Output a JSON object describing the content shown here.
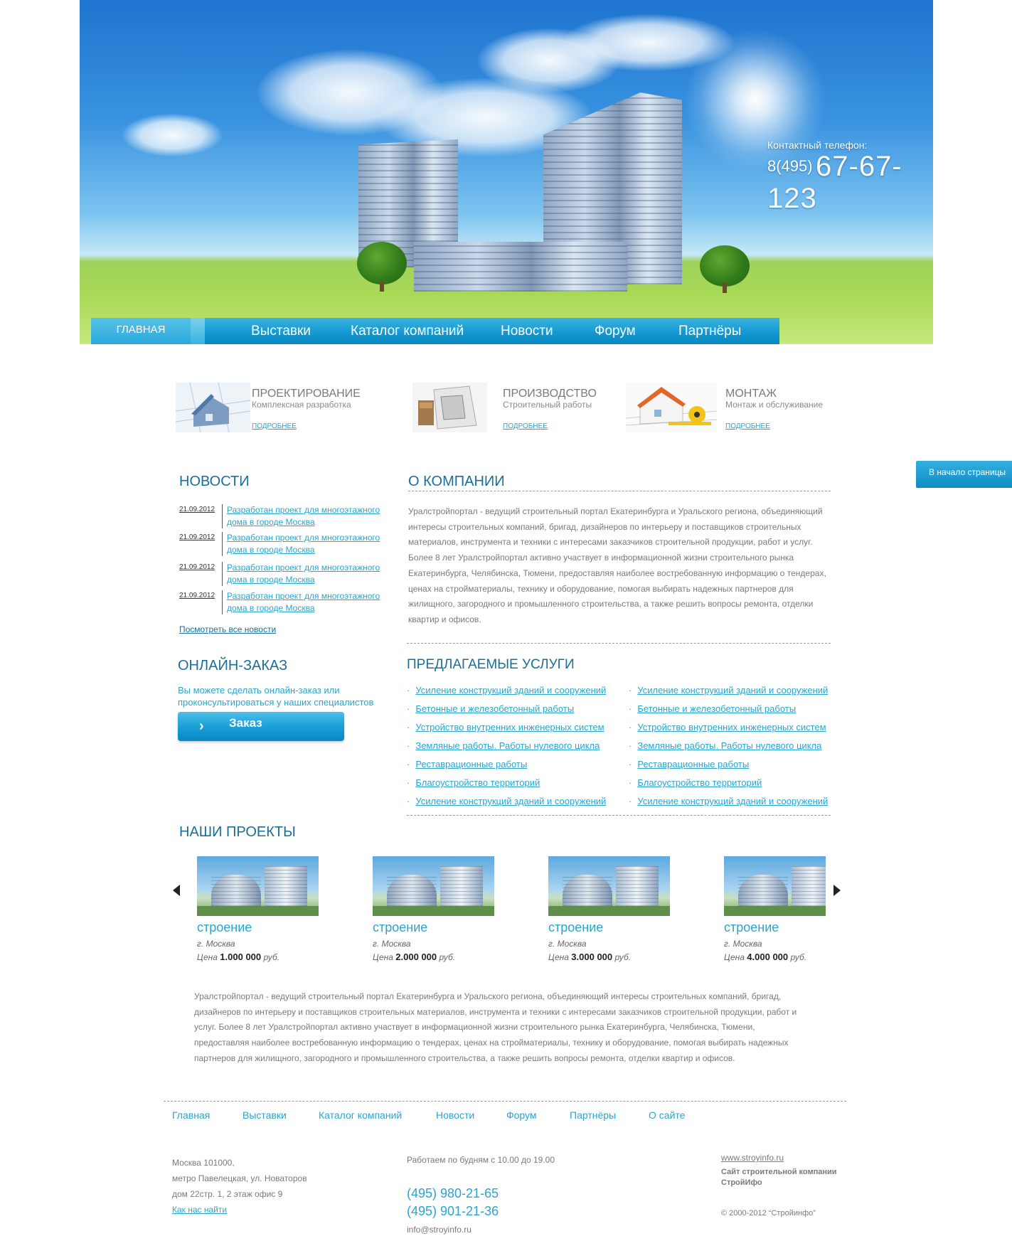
{
  "header": {
    "phone_label": "Контактный телефон:",
    "phone_prefix": "8(495)",
    "phone_number": "67-67-123"
  },
  "nav": {
    "home": "ГЛАВНАЯ",
    "items": [
      "Выставки",
      "Каталог компаний",
      "Новости",
      "Форум",
      "Партнёры"
    ]
  },
  "features": [
    {
      "title": "ПРОЕКТИРОВАНИЕ",
      "subtitle": "Комплексная разработка",
      "more": "ПОДРОБНЕЕ"
    },
    {
      "title": "ПРОИЗВОДСТВО",
      "subtitle": "Строительный работы",
      "more": "ПОДРОБНЕЕ"
    },
    {
      "title": "МОНТАЖ",
      "subtitle": "Монтаж и обслуживание",
      "more": "ПОДРОБНЕЕ"
    }
  ],
  "to_top": "В начало страницы",
  "news": {
    "title": "НОВОСТИ",
    "items": [
      {
        "date": "21.09.2012",
        "text": "Разработан проект для многоэтажного дома в городе Москва"
      },
      {
        "date": "21.09.2012",
        "text": "Разработан проект для многоэтажного дома в городе Москва"
      },
      {
        "date": "21.09.2012",
        "text": "Разработан проект для многоэтажного дома в городе Москва"
      },
      {
        "date": "21.09.2012",
        "text": "Разработан проект для многоэтажного дома в городе Москва"
      }
    ],
    "all_link": "Посмотреть все новости"
  },
  "online": {
    "title": "ОНЛАЙН-ЗАКАЗ",
    "text": "Вы можете сделать онлайн-заказ или проконсультироваться у наших специалистов",
    "button": "Заказ",
    "arrow": "›"
  },
  "about": {
    "title": "О КОМПАНИИ",
    "text": "Уралстройпортал - ведущий строительный портал Екатеринбурга и Уральского региона, объединяющий интересы строительных компаний, бригад, дизайнеров по интерьеру и поставщиков строительных материалов, инструмента и техники с интересами заказчиков строительной продукции, работ и услуг. Более 8 лет Уралстройпортал активно участвует в информационной жизни строительного рынка Екатеринбурга, Челябинска, Тюмени, предоставляя наиболее востребованную информацию о тендерах, ценах на стройматериалы, технику и оборудование, помогая выбирать надежных партнеров для жилищного, загородного и промышленного строительства, а также решить вопросы ремонта, отделки квартир и офисов."
  },
  "services": {
    "title": "ПРЕДЛАГАЕМЫЕ УСЛУГИ",
    "col1": [
      "Усиление конструкций зданий и сооружений",
      "Бетонные и железобетонный работы",
      "Устройство внутренних инженерных систем",
      "Земляные работы. Работы нулевого цикла",
      "Реставрационные работы",
      "Благоустройство территорий",
      "Усиление конструкций зданий и сооружений"
    ],
    "col2": [
      "Усиление конструкций зданий и сооружений",
      "Бетонные и железобетонный работы",
      "Устройство внутренних инженерных систем",
      "Земляные работы. Работы нулевого цикла",
      "Реставрационные работы",
      "Благоустройство территорий",
      "Усиление конструкций зданий и сооружений"
    ]
  },
  "projects": {
    "title": "НАШИ ПРОЕКТЫ",
    "items": [
      {
        "title": "строение",
        "city": "г. Москва",
        "price_label": "Цена",
        "price": "1.000 000",
        "currency": "руб."
      },
      {
        "title": "строение",
        "city": "г. Москва",
        "price_label": "Цена",
        "price": "2.000 000",
        "currency": "руб."
      },
      {
        "title": "строение",
        "city": "г. Москва",
        "price_label": "Цена",
        "price": "3.000 000",
        "currency": "руб."
      },
      {
        "title": "строение",
        "city": "г. Москва",
        "price_label": "Цена",
        "price": "4.000 000",
        "currency": "руб."
      }
    ]
  },
  "description": "Уралстройпортал - ведущий строительный портал Екатеринбурга и Уральского региона, объединяющий интересы строительных компаний, бригад, дизайнеров по интерьеру и поставщиков строительных материалов, инструмента и техники с интересами заказчиков строительной продукции, работ и услуг. Более 8 лет Уралстройпортал активно участвует в информационной жизни строительного рынка Екатеринбурга, Челябинска, Тюмени, предоставляя наиболее востребованную информацию о тендерах, ценах на стройматериалы, технику и оборудование, помогая выбирать надежных партнеров для жилищного, загородного и промышленного строительства, а также решить вопросы ремонта, отделки квартир и офисов.",
  "footer": {
    "nav": [
      "Главная",
      "Выставки",
      "Каталог компаний",
      "Новости",
      "Форум",
      "Партнёры",
      "О сайте"
    ],
    "address_1": "Москва 101000,",
    "address_2": "метро Павелецкая, ул. Новаторов",
    "address_3": "дом 22стр. 1, 2 этаж офис 9",
    "how_to_find": "Как нас найти",
    "hours": "Работаем по будням с 10.00 до 19.00",
    "phone_1": "(495) 980-21-65",
    "phone_2": "(495) 901-21-36",
    "email": "info@stroyinfo.ru",
    "site": "www.stroyinfo.ru",
    "site_desc_1": "Сайт строительной компании",
    "site_desc_2": "СтройИфо",
    "copyright": "© 2000-2012 “Стройинфо”"
  }
}
